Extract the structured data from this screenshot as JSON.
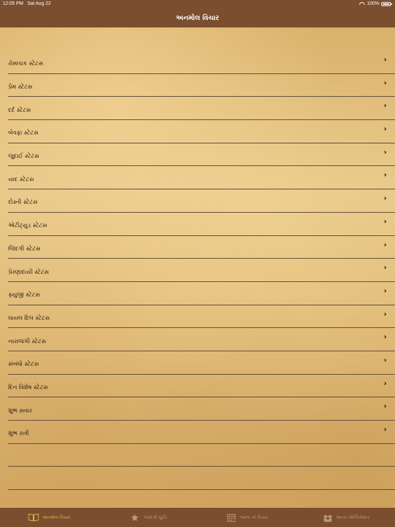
{
  "status": {
    "time": "12:05 PM",
    "date": "Sat Aug 22",
    "battery": "100%"
  },
  "nav": {
    "title": "અનમોલ વિચાર"
  },
  "list": [
    "રોમાંચક સ્ટેટસ",
    "પ્રેમ સ્ટેટસ",
    "દર્દ સ્ટેટસ",
    "બેવફા સ્ટેટસ",
    "જુદાઈ સ્ટેટસ",
    "યાદ સ્ટેટસ",
    "દોસ્તી સ્ટેટસ",
    "એટીટ્યુડ સ્ટેટસ",
    "જિંદગી સ્ટેટસ",
    "પ્રેરણાદાયી સ્ટેટસ",
    "ફ્યુજી સ્ટેટસ",
    "ઘાયલ દિલ સ્ટેટસ",
    "નારાજગી સ્ટેટસ",
    "સંબંધો સ્ટેટસ",
    "દિન વિશેષ સ્ટેટસ",
    "શુભ સવાર",
    "શુભ રાત્રી"
  ],
  "tabs": [
    {
      "label": "અનમોલ વિચાર",
      "icon": "book-icon",
      "active": true
    },
    {
      "label": "પસંદગી સુચિ",
      "icon": "star-icon",
      "active": false
    },
    {
      "label": "આજ નો વિચાર",
      "icon": "calendar-icon",
      "active": false
    },
    {
      "label": "અન્ય એપ્લિકેશન",
      "icon": "download-icon",
      "active": false
    }
  ],
  "colors": {
    "bar": "#7a4e2e",
    "active_tab": "#d6b84a",
    "inactive_tab": "#b89a7c"
  }
}
